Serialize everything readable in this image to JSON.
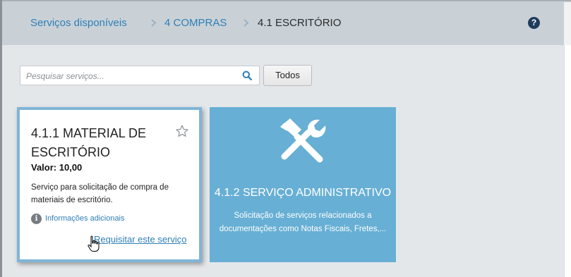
{
  "breadcrumb": {
    "items": [
      "Serviços disponíveis",
      "4 COMPRAS"
    ],
    "current": "4.1 ESCRITÓRIO"
  },
  "help": {
    "glyph": "?"
  },
  "search": {
    "placeholder": "Pesquisar serviços...",
    "value": "",
    "icon": "search-icon"
  },
  "filter_button": {
    "label": "Todos"
  },
  "services": [
    {
      "title": "4.1.1 MATERIAL DE ESCRITÓRIO",
      "price_label": "Valor:",
      "price_value": "10,00",
      "description": "Serviço para solicitação de compra de materiais de escritório.",
      "info_link": "Informações adicionais",
      "request_link": "Requisitar este serviço",
      "icon": "star-outline-icon"
    },
    {
      "title": "4.1.2 SERVIÇO ADMINISTRATIVO",
      "description": "Solicitação de serviços relacionados a documentações como Notas Fiscais, Fretes,...",
      "icon": "tools-icon"
    }
  ],
  "colors": {
    "accent": "#2f7fb6",
    "header_bg": "#c9d1d7",
    "card_highlight": "#67afd4",
    "page_bg": "#e4e7ea"
  }
}
